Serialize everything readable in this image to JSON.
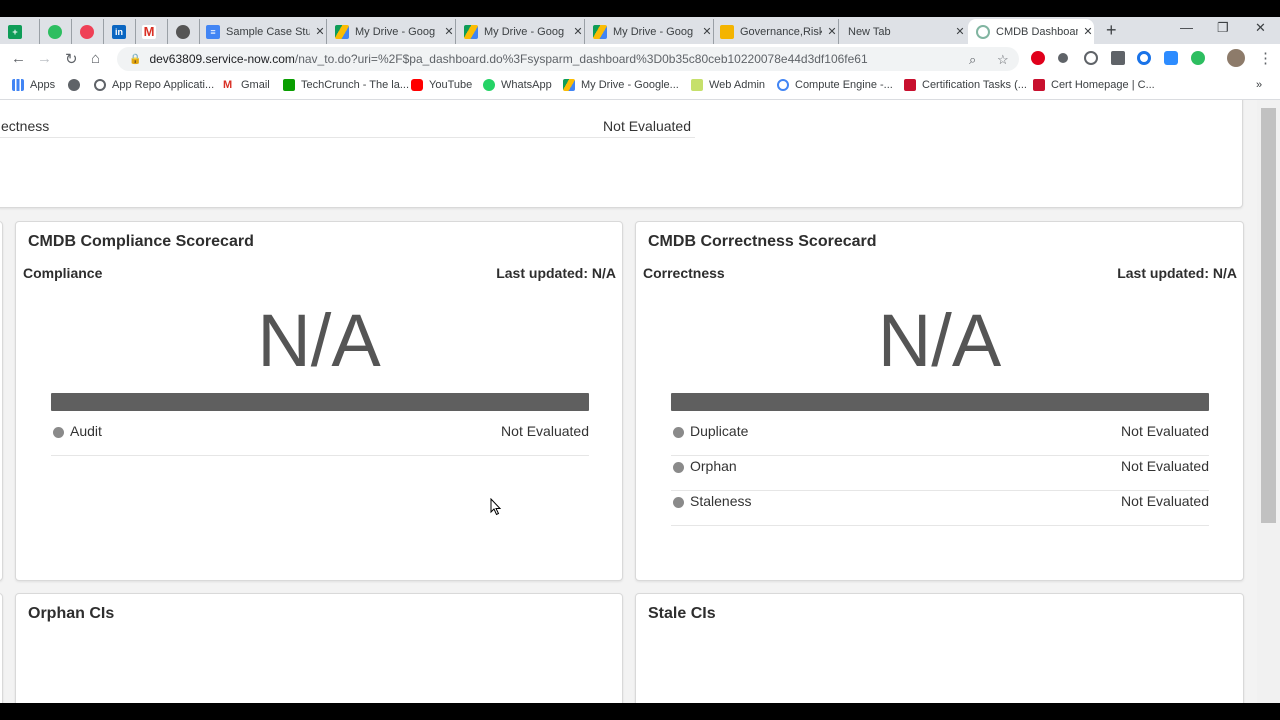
{
  "browser": {
    "tabs": [
      {
        "title": "",
        "icon": "sheets-icon",
        "color": "#0f9d58"
      },
      {
        "title": "",
        "icon": "evernote-icon",
        "color": "#2dbe60"
      },
      {
        "title": "",
        "icon": "pocket-icon",
        "color": "#ef4056"
      },
      {
        "title": "",
        "icon": "linkedin-icon",
        "color": "#0a66c2"
      },
      {
        "title": "",
        "icon": "gmail-icon",
        "color": "#d93025"
      },
      {
        "title": "",
        "icon": "github-icon",
        "color": "#333333"
      },
      {
        "title": "Sample Case Stu",
        "icon": "docs-icon",
        "color": "#4285f4"
      },
      {
        "title": "My Drive - Goog",
        "icon": "drive-icon",
        "color": "#fbbc04"
      },
      {
        "title": "My Drive - Goog",
        "icon": "drive-icon",
        "color": "#fbbc04"
      },
      {
        "title": "My Drive - Goog",
        "icon": "drive-icon",
        "color": "#fbbc04"
      },
      {
        "title": "Governance,Risk",
        "icon": "slides-icon",
        "color": "#f4b400"
      },
      {
        "title": "New Tab",
        "icon": "",
        "color": ""
      },
      {
        "title": "CMDB Dashboar",
        "icon": "servicenow-icon",
        "color": "#81b5a1"
      }
    ],
    "url_host": "dev63809.service-now.com",
    "url_path": "/nav_to.do?uri=%2F$pa_dashboard.do%3Fsysparm_dashboard%3D0b35c80ceb10220078e44d3df106fe61",
    "bookmarks": [
      {
        "label": "Apps",
        "icon": "apps-grid-icon"
      },
      {
        "label": "",
        "icon": "globe-icon"
      },
      {
        "label": "App Repo Applicati...",
        "icon": "servicenow-icon"
      },
      {
        "label": "Gmail",
        "icon": "gmail-icon"
      },
      {
        "label": "TechCrunch - The la...",
        "icon": "techcrunch-icon"
      },
      {
        "label": "YouTube",
        "icon": "youtube-icon"
      },
      {
        "label": "WhatsApp",
        "icon": "whatsapp-icon"
      },
      {
        "label": "My Drive - Google...",
        "icon": "drive-icon"
      },
      {
        "label": "Web Admin",
        "icon": "web-admin-icon"
      },
      {
        "label": "Compute Engine -...",
        "icon": "compute-engine-icon"
      },
      {
        "label": "Certification Tasks (...",
        "icon": "cert-icon"
      },
      {
        "label": "Cert Homepage | C...",
        "icon": "cert-icon"
      }
    ]
  },
  "top_card": {
    "row_label": "ectness",
    "row_value": "Not Evaluated"
  },
  "compliance": {
    "title": "CMDB Compliance Scorecard",
    "subtitle": "Compliance",
    "updated": "Last updated: N/A",
    "score": "N/A",
    "metrics": [
      {
        "name": "Audit",
        "value": "Not Evaluated"
      }
    ]
  },
  "correctness": {
    "title": "CMDB Correctness Scorecard",
    "subtitle": "Correctness",
    "updated": "Last updated: N/A",
    "score": "N/A",
    "metrics": [
      {
        "name": "Duplicate",
        "value": "Not Evaluated"
      },
      {
        "name": "Orphan",
        "value": "Not Evaluated"
      },
      {
        "name": "Staleness",
        "value": "Not Evaluated"
      }
    ]
  },
  "orphan": {
    "title": "Orphan CIs"
  },
  "stale": {
    "title": "Stale CIs"
  }
}
